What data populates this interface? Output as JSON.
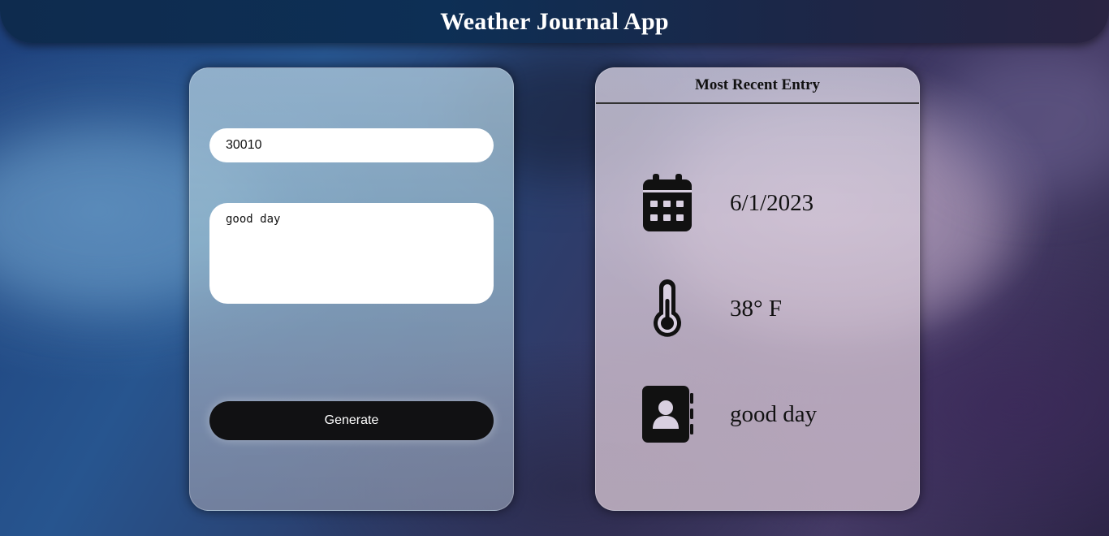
{
  "header": {
    "title": "Weather Journal App"
  },
  "form": {
    "zip_value": "30010",
    "feelings_value": "good day",
    "generate_label": "Generate"
  },
  "entry": {
    "title": "Most Recent Entry",
    "date": "6/1/2023",
    "temp": "38° F",
    "content": "good day"
  },
  "icons": {
    "date": "calendar-icon",
    "temp": "thermometer-icon",
    "content": "contact-book-icon"
  },
  "colors": {
    "header_bg": "#0d2f55",
    "button_bg": "#111113",
    "text_dark": "#111111",
    "white": "#ffffff"
  }
}
